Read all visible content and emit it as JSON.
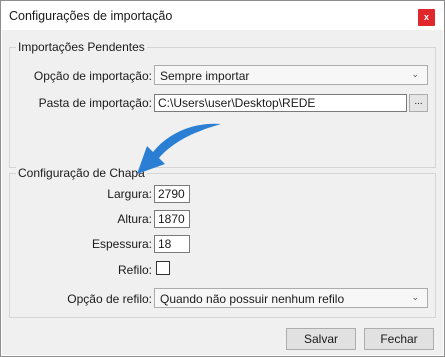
{
  "window": {
    "title": "Configurações de importação",
    "close_label": "x"
  },
  "pending": {
    "legend": "Importações Pendentes",
    "import_option_label": "Opção de importação:",
    "import_option_value": "Sempre importar",
    "import_folder_label": "Pasta de importação:",
    "import_folder_value": "C:\\Users\\user\\Desktop\\REDE",
    "browse_label": "..."
  },
  "sheet": {
    "legend": "Configuração de Chapa",
    "width_label": "Largura:",
    "width_value": "2790",
    "height_label": "Altura:",
    "height_value": "1870",
    "thickness_label": "Espessura:",
    "thickness_value": "18",
    "trim_label": "Refilo:",
    "trim_checked": false,
    "trim_option_label": "Opção de refilo:",
    "trim_option_value": "Quando não possuir nenhum refilo"
  },
  "buttons": {
    "save": "Salvar",
    "close": "Fechar"
  },
  "icons": {
    "dropdown": "chevron-down-icon",
    "annotation": "curved-arrow-icon"
  },
  "colors": {
    "close_button": "#e0282c",
    "annotation_arrow": "#2a7fd4"
  }
}
